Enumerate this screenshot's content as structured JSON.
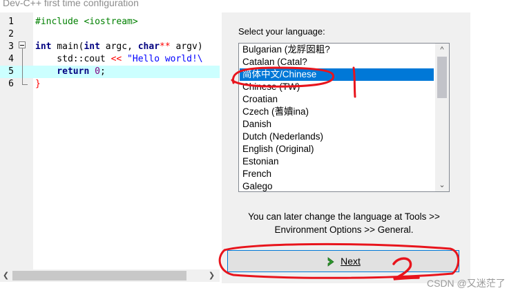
{
  "window": {
    "title": "Dev-C++ first time configuration"
  },
  "editor": {
    "line_numbers": [
      "1",
      "2",
      "3",
      "4",
      "5",
      "6"
    ],
    "lines": [
      "#include <iostream>",
      "",
      "int main(int argc, char** argv) {",
      "    std::cout << \"Hello world!\\n\";",
      "    return 0;",
      "}"
    ],
    "tokens": {
      "l1": "#include <iostream>",
      "l3_int": "int",
      "l3_main": " main(",
      "l3_int2": "int",
      "l3_argc": " argc, ",
      "l3_char": "char",
      "l3_stars": "**",
      "l3_argv": " argv)",
      "l4_pre": "    std::cout ",
      "l4_op": "<<",
      "l4_str": " \"Hello world!\\",
      "l5_ret": "    return",
      "l5_num": " 0",
      "l5_semi": ";",
      "l6": "}"
    }
  },
  "language_panel": {
    "label": "Select your language:",
    "items": [
      "Bulgarian (龙脬囡耝?",
      "Catalan (Catal?",
      "简体中文/Chinese",
      "Chinese (TW)",
      "Croatian",
      "Czech (蓍嬇ina)",
      "Danish",
      "Dutch (Nederlands)",
      "English (Original)",
      "Estonian",
      "French",
      "Galego"
    ],
    "selected": "简体中文/Chinese",
    "hint_line1": "You can later change the language at Tools >>",
    "hint_line2": "Environment Options >> General.",
    "next_button": "Next"
  },
  "annotations": {
    "mark1": "1",
    "mark2": "2",
    "ink_color": "#e8141c"
  },
  "watermark": "CSDN @又迷茫了",
  "colors": {
    "selection": "#0078d7",
    "current_line": "#ccffff",
    "keyword": "#000080",
    "string": "#0000ff"
  }
}
